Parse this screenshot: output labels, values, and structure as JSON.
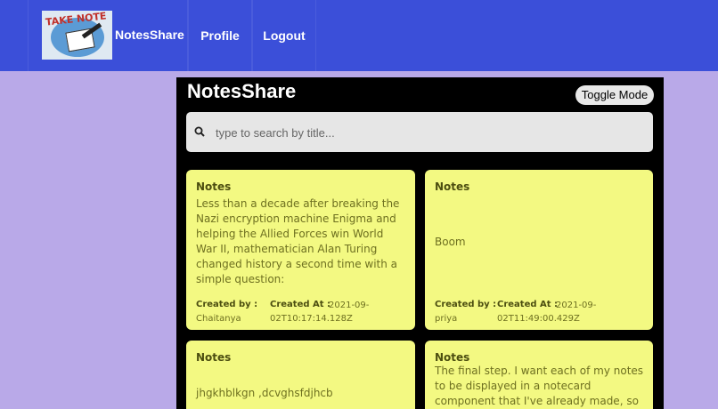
{
  "navbar": {
    "logo_text": "TAKE NOTE",
    "brand": "NotesShare",
    "links": [
      "Profile",
      "Logout"
    ]
  },
  "app": {
    "title": "NotesShare",
    "toggle_label": "Toggle Mode",
    "search_placeholder": "type to search by title..."
  },
  "notes": [
    {
      "heading": "Notes",
      "body": "Less than a decade after breaking the Nazi encryption machine Enigma and helping the Allied Forces win World War II, mathematician Alan Turing changed history a second time with a simple question:",
      "created_by_label": "Created by :",
      "created_by": "Chaitanya",
      "created_at_label": "Created At :",
      "created_at": "2021-09-02T10:17:14.128Z"
    },
    {
      "heading": "Notes",
      "body": "Boom",
      "created_by_label": "Created by :",
      "created_by": "priya",
      "created_at_label": "Created At :",
      "created_at": "2021-09-02T11:49:00.429Z"
    },
    {
      "heading": "Notes",
      "body": "jhgkhblkgn ,dcvghsfdjhcb"
    },
    {
      "heading": "Notes",
      "body": "The final step. I want each of my notes to be displayed in a notecard component that I've already made, so I passed my API data"
    }
  ]
}
